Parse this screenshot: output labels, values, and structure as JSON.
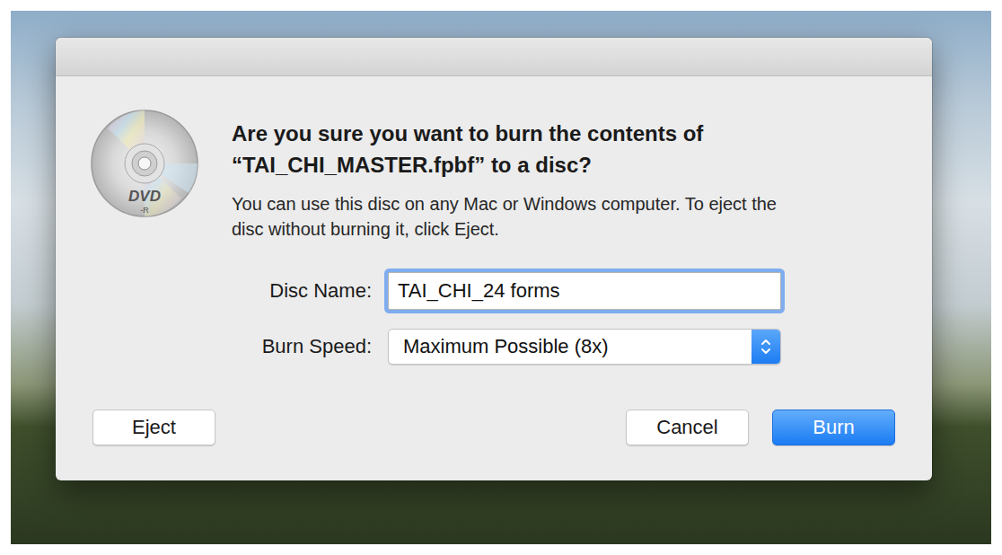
{
  "dialog": {
    "icon": {
      "label": "DVD",
      "sublabel": "-R"
    },
    "heading": [
      "Are you sure you want to burn the contents of",
      "“TAI_CHI_MASTER.fpbf” to a disc?"
    ],
    "message": [
      "You can use this disc on any Mac or Windows computer. To eject the",
      "disc without burning it, click Eject."
    ]
  },
  "fields": [
    {
      "kind": "text",
      "label": "Disc Name:",
      "value": "TAI_CHI_24 forms",
      "focused": true
    },
    {
      "kind": "select",
      "label": "Burn Speed:",
      "value": "Maximum Possible (8x)",
      "focused": false
    }
  ],
  "left_buttons": [
    {
      "label": "Eject",
      "default": false
    }
  ],
  "right_buttons": [
    {
      "label": "Cancel",
      "default": false
    },
    {
      "label": "Burn",
      "default": true
    }
  ]
}
